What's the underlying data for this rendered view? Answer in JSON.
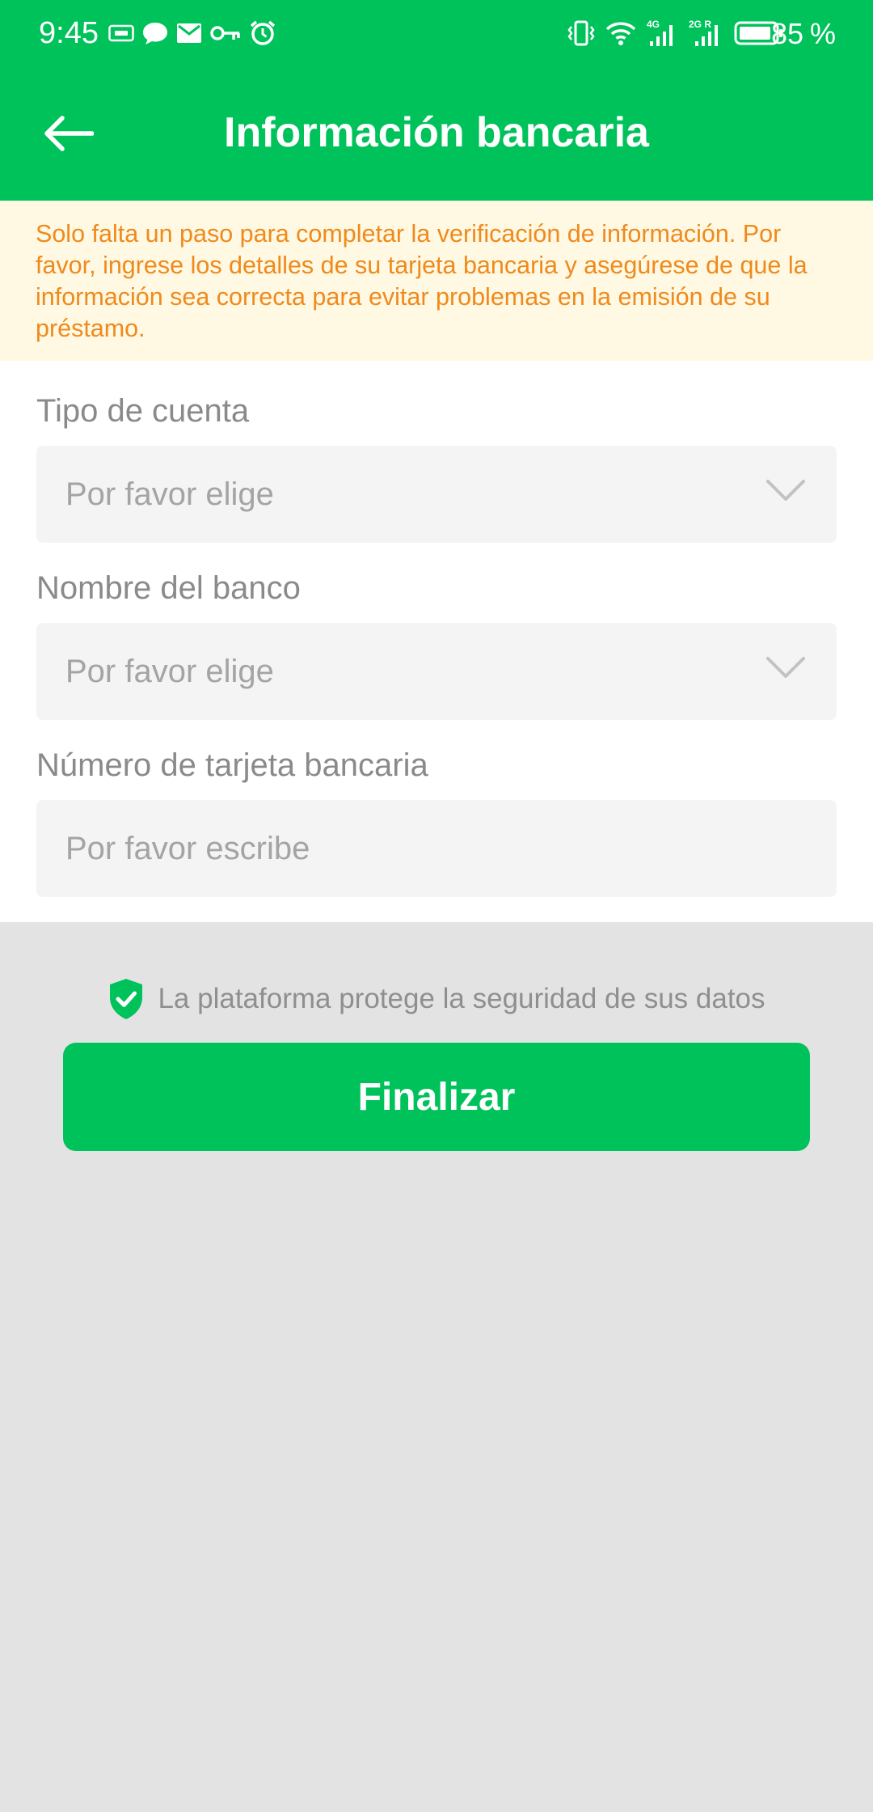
{
  "status_bar": {
    "time": "9:45",
    "battery_percent": "85",
    "battery_unit": "%",
    "left_icons": [
      "sim-card-icon",
      "chat-bubble-icon",
      "mail-icon",
      "key-icon",
      "alarm-icon"
    ],
    "right_icons": [
      "vibrate-icon",
      "wifi-icon",
      "signal-4g-icon",
      "signal-2g-icon",
      "battery-icon"
    ],
    "signal_labels": [
      "4G",
      "2G R"
    ]
  },
  "header": {
    "title": "Información bancaria",
    "back_icon": "arrow-left-icon"
  },
  "notice": {
    "text": "Solo falta un paso para completar la verificación de información. Por favor, ingrese los detalles de su tarjeta bancaria y asegúrese de que la información sea correcta para evitar problemas en la emisión de su préstamo."
  },
  "form": {
    "account_type": {
      "label": "Tipo de cuenta",
      "placeholder": "Por favor elige",
      "icon": "chevron-down-icon"
    },
    "bank_name": {
      "label": "Nombre del banco",
      "placeholder": "Por favor elige",
      "icon": "chevron-down-icon"
    },
    "card_number": {
      "label": "Número de tarjeta bancaria",
      "placeholder": "Por favor escribe"
    }
  },
  "footer": {
    "security_text": "La plataforma protege la seguridad de sus datos",
    "security_icon": "shield-check-icon",
    "finish_label": "Finalizar"
  },
  "colors": {
    "brand_green": "#00c25b",
    "notice_text": "#ef8a1c",
    "notice_bg": "#fff8e3",
    "page_bg": "#e3e3e3"
  }
}
